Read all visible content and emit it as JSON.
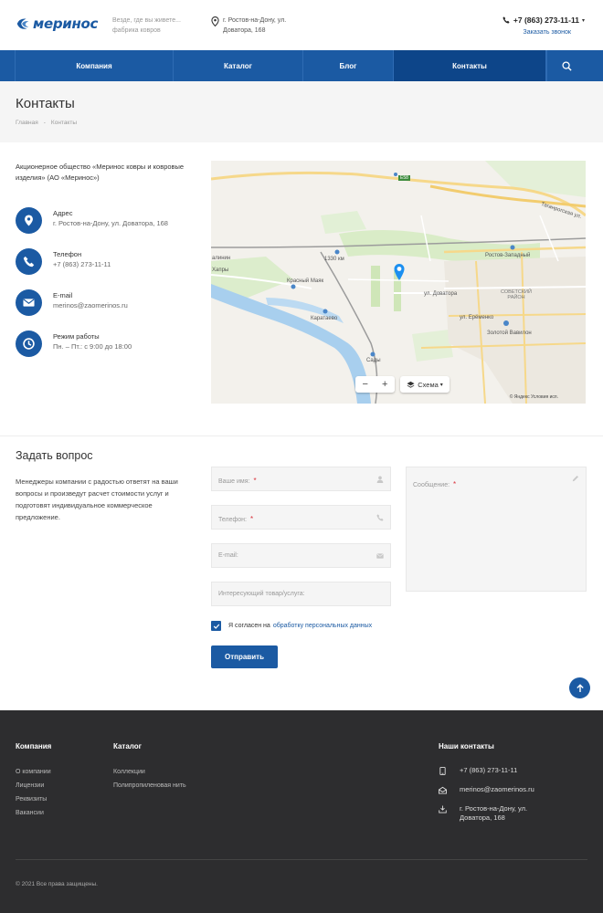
{
  "header": {
    "logo_text": "меринос",
    "slogan": "Везде, где вы живете... фабрика ковров",
    "address": "г. Ростов-на-Дону, ул. Доватора, 168",
    "phone": "+7 (863) 273-11-11",
    "callback": "Заказать звонок"
  },
  "nav": {
    "items": [
      {
        "label": "Компания"
      },
      {
        "label": "Каталог"
      },
      {
        "label": "Блог"
      },
      {
        "label": "Контакты"
      }
    ]
  },
  "page": {
    "title": "Контакты",
    "breadcrumb": {
      "home": "Главная",
      "current": "Контакты"
    }
  },
  "contacts": {
    "company": "Акционерное общество «Меринос ковры и ковровые изделия» (АО «Меринос»)",
    "items": [
      {
        "label": "Адрес",
        "value": "г. Ростов-на-Дону, ул. Доватора, 168",
        "icon": "location-pin-icon"
      },
      {
        "label": "Телефон",
        "value": "+7 (863) 273-11-11",
        "icon": "phone-icon"
      },
      {
        "label": "E-mail",
        "value": "merinos@zaomerinos.ru",
        "icon": "envelope-icon"
      },
      {
        "label": "Режим работы",
        "value": "Пн. – Пт.: с 9:00 до 18:00",
        "icon": "clock-icon"
      }
    ]
  },
  "map": {
    "scheme_label": "Схема",
    "zoom_out": "−",
    "zoom_in": "+",
    "labels": {
      "taganrog": "Таганрогская ул.",
      "rostov_west": "Ростов-Западный",
      "km1330": "1330 км",
      "krasny_mayak": "Красный Маяк",
      "dovatora": "ул. Доватора",
      "sovetsky": "СОВЕТСКИЙ РАЙОН",
      "karataevo": "Каратаево",
      "eremenko": "ул. Ерёменко",
      "zolotoy": "Золотой Вавилон",
      "sady": "Сады",
      "khapry": "Хапры",
      "malinin": "алинин",
      "e58": "E58",
      "yandex": "© Яндекс Условия исп."
    }
  },
  "form": {
    "title": "Задать вопрос",
    "description": "Менеджеры компании с радостью ответят на ваши вопросы и произведут расчет стоимости услуг и подготовят индивидуальное коммерческое предложение.",
    "name_placeholder": "Ваше имя:",
    "phone_placeholder": "Телефон:",
    "email_placeholder": "E-mail:",
    "product_placeholder": "Интересующий товар/услуга:",
    "message_placeholder": "Сообщение:",
    "required_mark": "*",
    "agree_text": "Я согласен на",
    "agree_link": "обработку персональных данных",
    "submit": "Отправить"
  },
  "footer": {
    "company_head": "Компания",
    "company_links": [
      "О компании",
      "Лицензии",
      "Реквизиты",
      "Вакансии"
    ],
    "catalog_head": "Каталог",
    "catalog_links": [
      "Коллекции",
      "Полипропиленовая нить"
    ],
    "contacts_head": "Наши контакты",
    "phone": "+7 (863) 273-11-11",
    "email": "merinos@zaomerinos.ru",
    "address": "г. Ростов-на-Дону, ул. Доватора, 168",
    "copyright": "© 2021 Все права защищены."
  },
  "colors": {
    "brand": "#1b5aa3",
    "nav_active": "#0d4589",
    "footer_bg": "#2d2d2f",
    "required": "#d9323b"
  }
}
